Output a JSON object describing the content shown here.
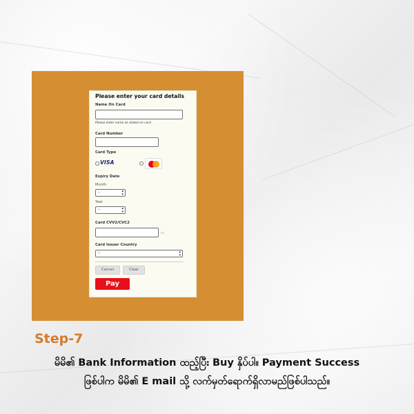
{
  "form": {
    "title": "Please enter your card details",
    "name_label": "Name On Card",
    "name_hint": "Please enter name as stated on card",
    "card_number_label": "Card Number",
    "card_type_label": "Card Type",
    "visa_label": "VISA",
    "expiry_label": "Expiry Date",
    "month_label": "Month",
    "month_value": "--",
    "year_label": "Year",
    "year_value": "--",
    "cvv_label": "Card CVV2/CVC2",
    "issuer_label": "Card Issuer Country",
    "issuer_value": "--",
    "cancel_label": "Cancel",
    "clear_label": "Clear",
    "pay_label": "Pay"
  },
  "step": {
    "title": "Step-7",
    "line1": "မိမိ၏ Bank Information ထည့်ပြီး Buy နှိပ်ပါ။ Payment Success",
    "line2": "ဖြစ်ပါက မိမိ၏ E mail သို့ လက်မှတ်ရောက်ရှိလာမည်ဖြစ်ပါသည်။"
  },
  "colors": {
    "accent_orange": "#d68e33",
    "step_orange": "#d37c2c",
    "pay_red": "#e8101a"
  }
}
